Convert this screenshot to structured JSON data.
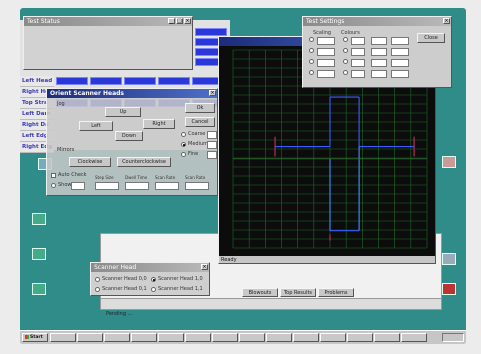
{
  "windows": {
    "top_left_title": "Test Status",
    "dialog_title": "Orient Scanner Heads",
    "plot_title": "",
    "settings_title": "Test Settings",
    "selector_title": "Scanner Head"
  },
  "left_panel": {
    "rows": [
      "Left Head",
      "Right Head",
      "Top Stra",
      "Left Dam",
      "Right Da",
      "Left Edg",
      "Right Edg"
    ]
  },
  "orient_dialog": {
    "group_label": "Jog",
    "up": "Up",
    "left": "Left",
    "right": "Right",
    "down": "Down",
    "ok": "Ok",
    "cancel": "Cancel",
    "speed_options": [
      "Coarse",
      "Medium",
      "Fine"
    ],
    "speed_values": [
      "",
      "",
      ""
    ],
    "mirrors_label": "Mirrors",
    "clockwise": "Clockwise",
    "counterclockwise": "Counterclockwise",
    "auto_check": "Auto Check",
    "show_label": "Show",
    "show_value": "",
    "bottom_labels": [
      "Step Size",
      "Dwell Time",
      "Scan Rate",
      "Scan Rate"
    ],
    "bottom_values": [
      "",
      "",
      "",
      ""
    ]
  },
  "plot": {
    "status": "Ready",
    "left_labels": [
      "",
      "",
      "",
      "",
      "",
      "",
      "",
      "",
      "",
      "",
      "",
      "",
      "",
      "",
      "",
      "",
      "",
      "",
      "",
      "",
      "",
      "",
      ""
    ],
    "bottom_labels": [
      "",
      "",
      "",
      "",
      "",
      "",
      "",
      "",
      "",
      "",
      "",
      ""
    ]
  },
  "settings": {
    "col1_label": "Scaling",
    "col2_label": "Colours",
    "col3_label": "",
    "col4_label": "",
    "close": "Close",
    "rows": [
      {
        "a": "",
        "b": "",
        "c": "",
        "d": ""
      },
      {
        "a": "",
        "b": "",
        "c": "",
        "d": ""
      },
      {
        "a": "",
        "b": "",
        "c": "",
        "d": ""
      },
      {
        "a": "",
        "b": "",
        "c": "",
        "d": ""
      }
    ]
  },
  "selector": {
    "options": [
      "Scanner Head 0,0",
      "Scanner Head 1,0",
      "Scanner Head 0,1",
      "Scanner Head 1,1"
    ]
  },
  "lower_tabs": [
    "Blowouts",
    "Top Results",
    "Problems"
  ],
  "status_line": "Pending ...",
  "desktop_icons": [
    "",
    "",
    "",
    "",
    "",
    "",
    ""
  ],
  "taskbar": {
    "start": "Start",
    "items": [
      "",
      "",
      "",
      "",
      "",
      "",
      "",
      "",
      "",
      "",
      "",
      "",
      "",
      ""
    ]
  },
  "colors": {
    "desktop": "#2f8c89",
    "plot_bg": "#0c0c0c",
    "plot_grid": "#1f6b2a",
    "cross_top": "#3a5dff",
    "cross_mid": "#3b93ff",
    "cross_red": "#e0306a",
    "title_active": "#1b2c7a"
  },
  "cross_path": [
    {
      "x": 0.0,
      "y": 6.0
    },
    {
      "x": 0.0,
      "y": 1.2
    },
    {
      "x": 1.8,
      "y": 1.2
    },
    {
      "x": 1.8,
      "y": -1.4
    },
    {
      "x": -1.4,
      "y": -1.4
    },
    {
      "x": -1.4,
      "y": -6.6
    }
  ]
}
